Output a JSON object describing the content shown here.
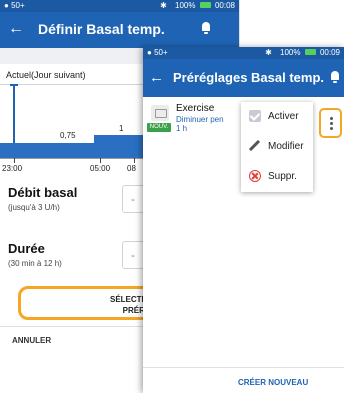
{
  "back_screen": {
    "status": {
      "left": "50+",
      "battery_pct": "100%",
      "time": "00:08"
    },
    "title": "Définir Basal temp.",
    "chart": {
      "label": "Actuel(Jour suivant)",
      "value_labels": [
        "0,75",
        "1"
      ],
      "tick_labels": [
        "23:00",
        "05:00",
        "08"
      ]
    },
    "basal_rate": {
      "title": "Débit basal",
      "hint": "(jusqu'à 3 U/h)",
      "value": "- -"
    },
    "duration": {
      "title": "Durée",
      "hint": "(30 min à 12 h)",
      "value": "- -"
    },
    "select_button": {
      "line1": "SÉLECTIONNER DE",
      "line2": "PRÉRÉGLAG"
    },
    "cancel_label": "ANNULER"
  },
  "front_screen": {
    "status": {
      "left": "50+",
      "battery_pct": "100%",
      "time": "00:09"
    },
    "title": "Préréglages Basal temp.",
    "preset": {
      "name": "Exercise",
      "description": "Diminuer pen",
      "duration": "1 h",
      "badge": "NOUV."
    },
    "menu": {
      "items": [
        {
          "label": "Activer",
          "icon": "checkbox-icon"
        },
        {
          "label": "Modifier",
          "icon": "pencil-icon"
        },
        {
          "label": "Suppr.",
          "icon": "delete-icon"
        }
      ]
    },
    "create_new_label": "CRÉER NOUVEAU"
  },
  "colors": {
    "primary_blue": "#1f64b4",
    "highlight_orange": "#f5a623",
    "new_badge_green": "#3aa14a",
    "delete_red": "#e53935"
  }
}
